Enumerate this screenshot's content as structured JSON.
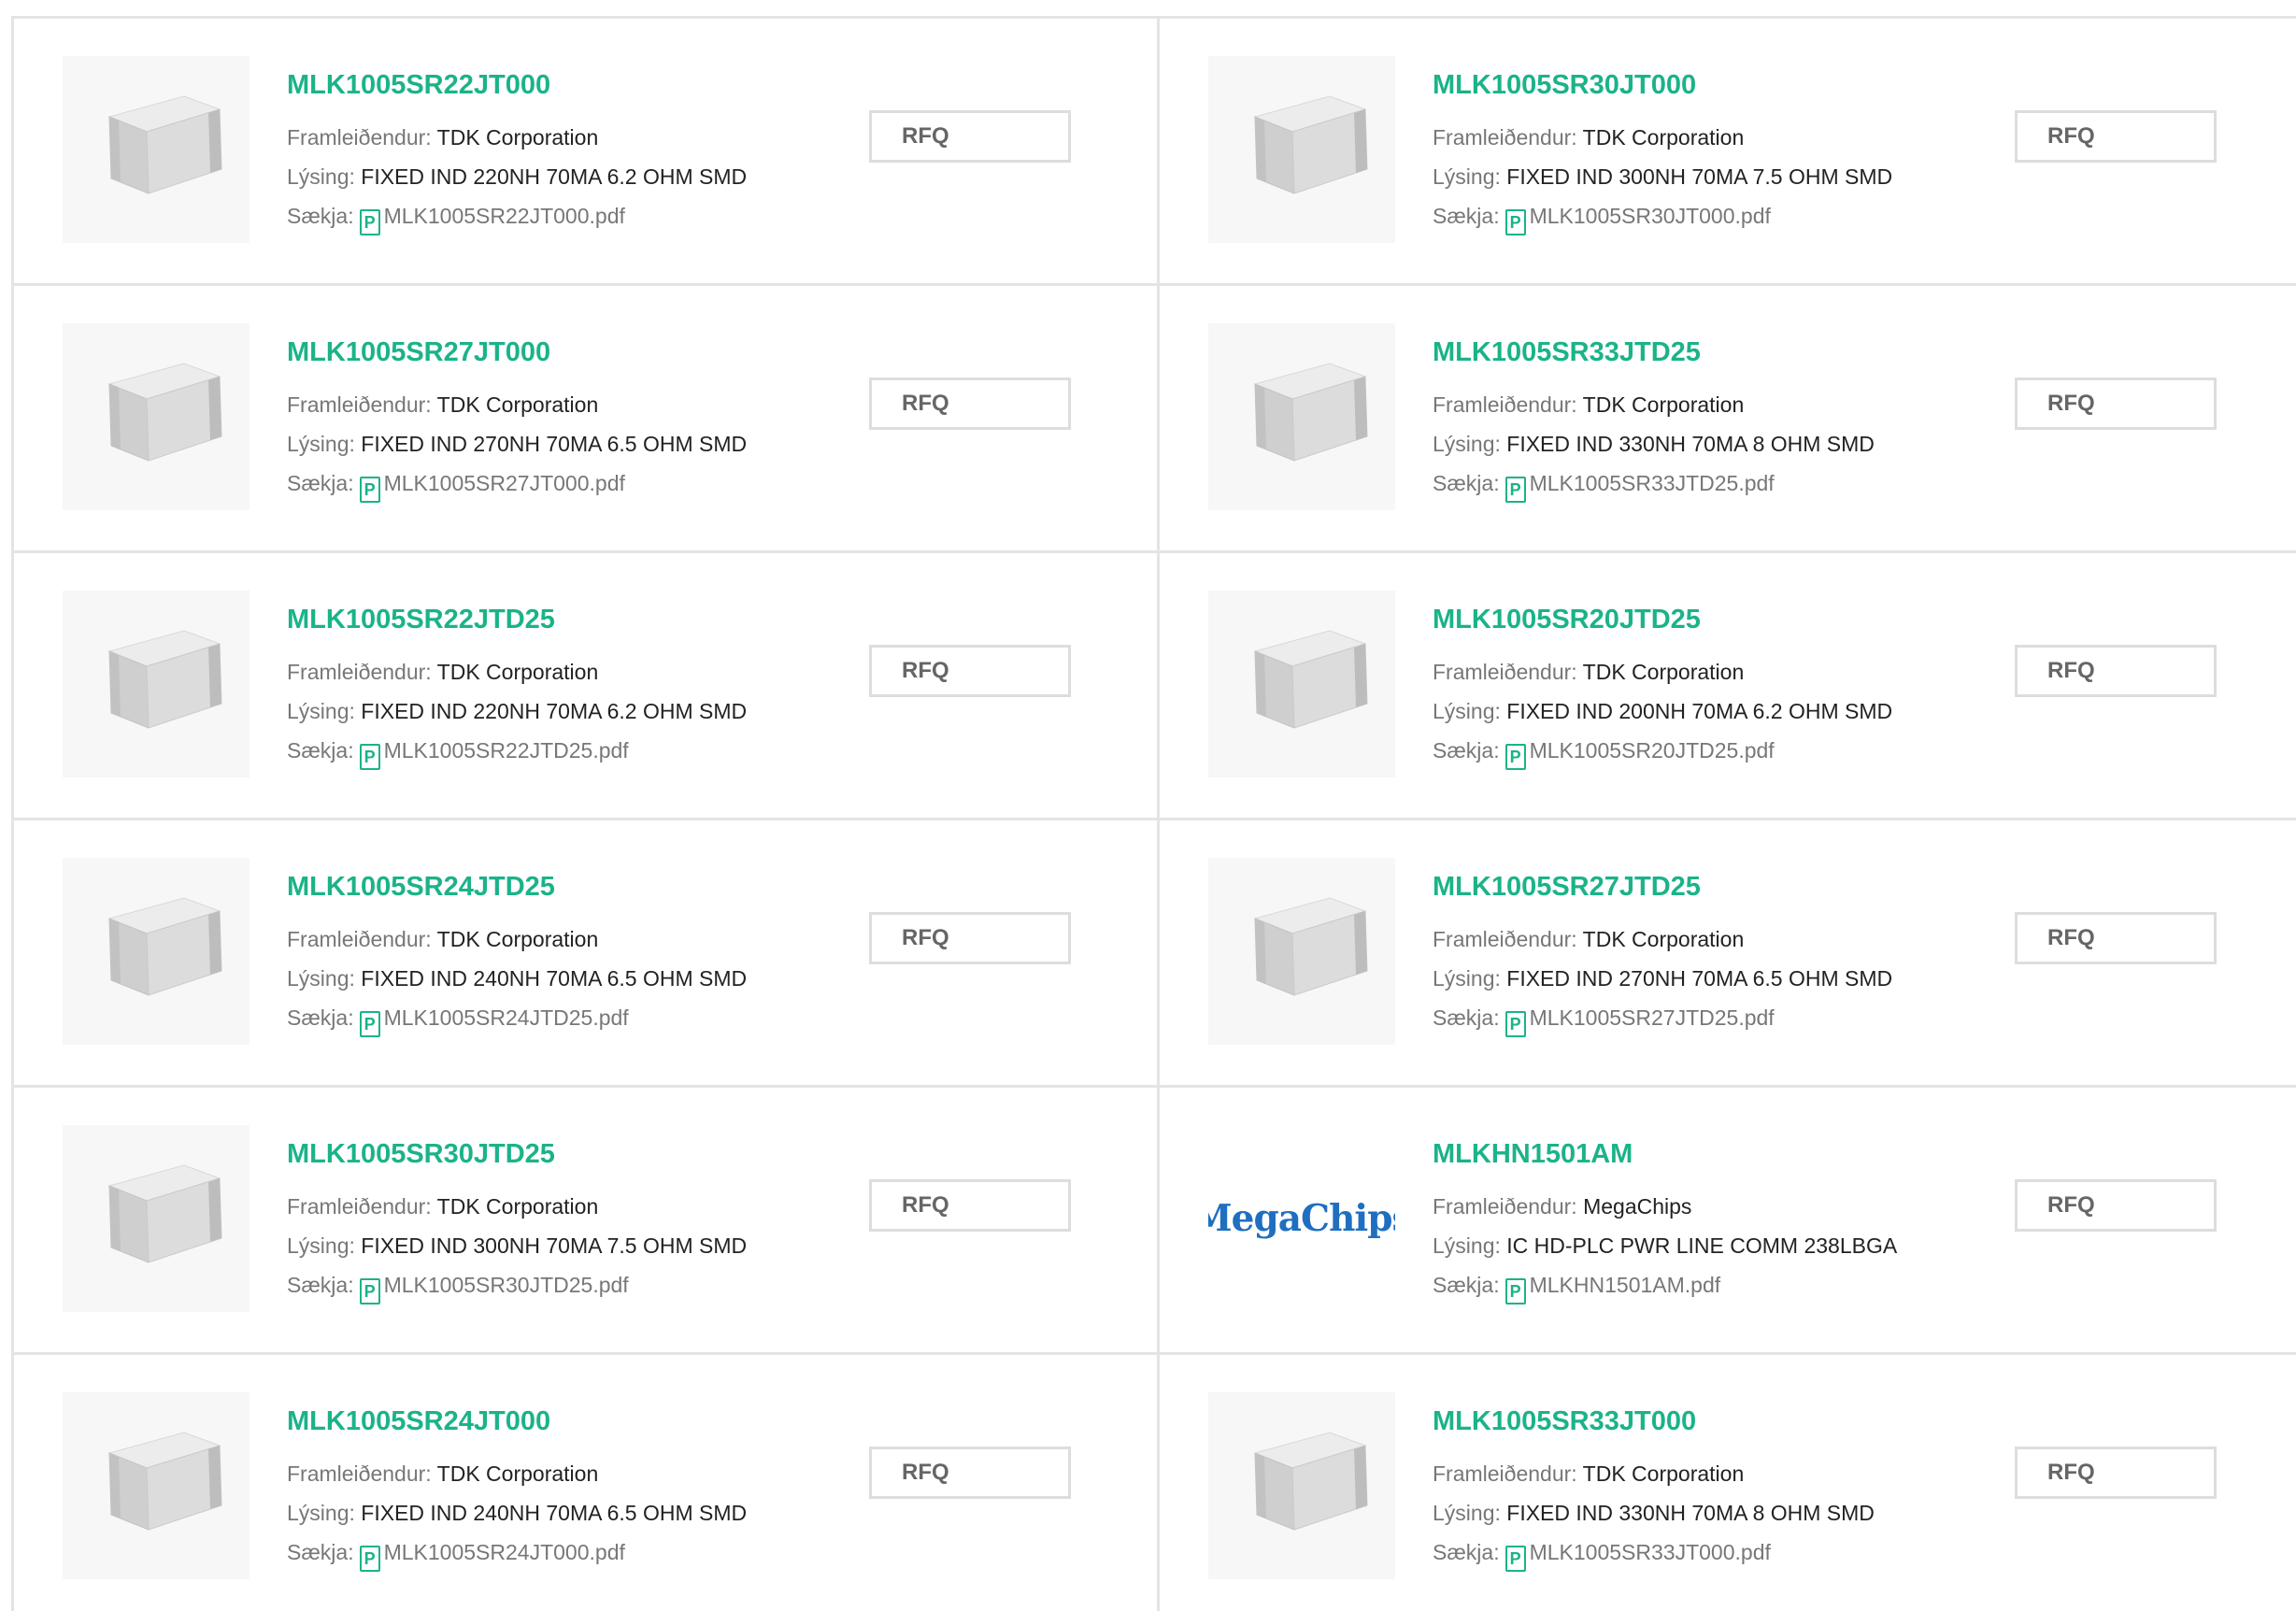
{
  "labels": {
    "manufacturer": "Framleiðendur:",
    "description": "Lýsing:",
    "download": "Sækja:",
    "rfq": "RFQ",
    "pdf_glyph": "P"
  },
  "colors": {
    "accent": "#1bb389",
    "brand_megachips": "#1f6fc0"
  },
  "products": [
    {
      "part": "MLK1005SR22JT000",
      "manufacturer": "TDK Corporation",
      "description": "FIXED IND 220NH 70MA 6.2 OHM SMD",
      "file": "MLK1005SR22JT000.pdf",
      "image": "inductor-chip-image"
    },
    {
      "part": "MLK1005SR30JT000",
      "manufacturer": "TDK Corporation",
      "description": "FIXED IND 300NH 70MA 7.5 OHM SMD",
      "file": "MLK1005SR30JT000.pdf",
      "image": "inductor-chip-image"
    },
    {
      "part": "MLK1005SR27JT000",
      "manufacturer": "TDK Corporation",
      "description": "FIXED IND 270NH 70MA 6.5 OHM SMD",
      "file": "MLK1005SR27JT000.pdf",
      "image": "inductor-chip-image"
    },
    {
      "part": "MLK1005SR33JTD25",
      "manufacturer": "TDK Corporation",
      "description": "FIXED IND 330NH 70MA 8 OHM SMD",
      "file": "MLK1005SR33JTD25.pdf",
      "image": "inductor-chip-image"
    },
    {
      "part": "MLK1005SR22JTD25",
      "manufacturer": "TDK Corporation",
      "description": "FIXED IND 220NH 70MA 6.2 OHM SMD",
      "file": "MLK1005SR22JTD25.pdf",
      "image": "inductor-chip-image"
    },
    {
      "part": "MLK1005SR20JTD25",
      "manufacturer": "TDK Corporation",
      "description": "FIXED IND 200NH 70MA 6.2 OHM SMD",
      "file": "MLK1005SR20JTD25.pdf",
      "image": "inductor-chip-image"
    },
    {
      "part": "MLK1005SR24JTD25",
      "manufacturer": "TDK Corporation",
      "description": "FIXED IND 240NH 70MA 6.5 OHM SMD",
      "file": "MLK1005SR24JTD25.pdf",
      "image": "inductor-chip-image"
    },
    {
      "part": "MLK1005SR27JTD25",
      "manufacturer": "TDK Corporation",
      "description": "FIXED IND 270NH 70MA 6.5 OHM SMD",
      "file": "MLK1005SR27JTD25.pdf",
      "image": "inductor-chip-image"
    },
    {
      "part": "MLK1005SR30JTD25",
      "manufacturer": "TDK Corporation",
      "description": "FIXED IND 300NH 70MA 7.5 OHM SMD",
      "file": "MLK1005SR30JTD25.pdf",
      "image": "inductor-chip-image"
    },
    {
      "part": "MLKHN1501AM",
      "manufacturer": "MegaChips",
      "description": "IC HD-PLC PWR LINE COMM 238LBGA",
      "file": "MLKHN1501AM.pdf",
      "image": "megachips-logo",
      "logo_text": "MegaChips"
    },
    {
      "part": "MLK1005SR24JT000",
      "manufacturer": "TDK Corporation",
      "description": "FIXED IND 240NH 70MA 6.5 OHM SMD",
      "file": "MLK1005SR24JT000.pdf",
      "image": "inductor-chip-image"
    },
    {
      "part": "MLK1005SR33JT000",
      "manufacturer": "TDK Corporation",
      "description": "FIXED IND 330NH 70MA 8 OHM SMD",
      "file": "MLK1005SR33JT000.pdf",
      "image": "inductor-chip-image"
    }
  ]
}
